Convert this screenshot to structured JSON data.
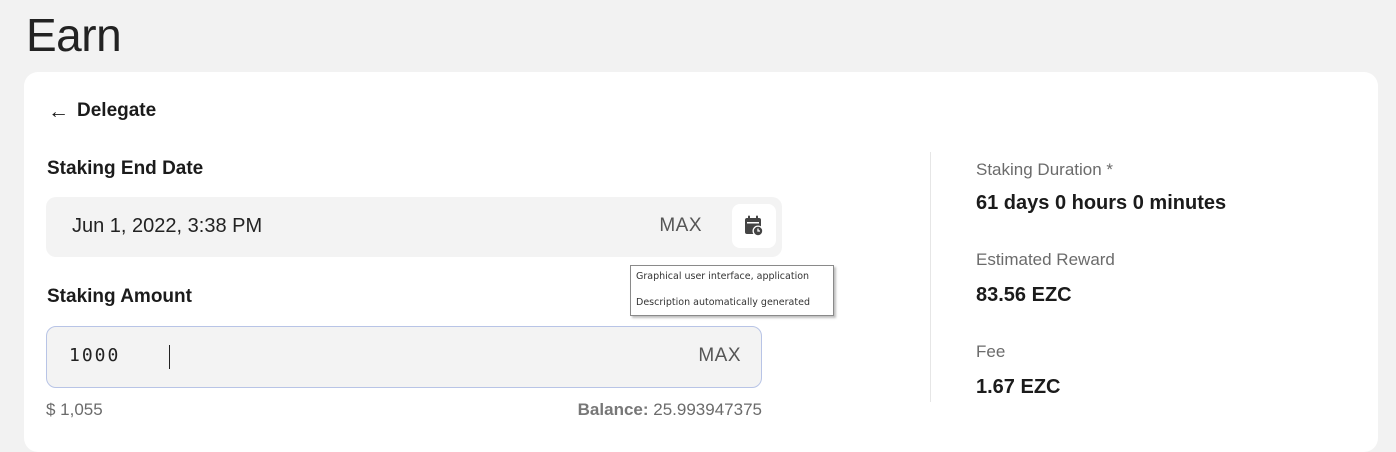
{
  "page": {
    "title": "Earn"
  },
  "back": {
    "label": "Delegate"
  },
  "end_date": {
    "label": "Staking End Date",
    "value": "Jun 1, 2022, 3:38 PM",
    "max_label": "MAX"
  },
  "amount": {
    "label": "Staking Amount",
    "value": "1000",
    "max_label": "MAX",
    "usd": "$ 1,055",
    "balance_label": "Balance:",
    "balance_value": "25.993947375"
  },
  "stats": {
    "duration_label": "Staking Duration *",
    "duration_value": "61 days 0 hours 0 minutes",
    "reward_label": "Estimated Reward",
    "reward_value": "83.56 EZC",
    "fee_label": "Fee",
    "fee_value": "1.67 EZC"
  },
  "tooltip": {
    "line1": "Graphical user interface, application",
    "line2": "Description automatically generated"
  },
  "icons": {
    "back": "arrow-left-icon",
    "calendar": "calendar-clock-icon"
  },
  "colors": {
    "background": "#f2f2f2",
    "card": "#ffffff",
    "field": "#f3f3f3",
    "focus_border": "#b8c4e6"
  }
}
